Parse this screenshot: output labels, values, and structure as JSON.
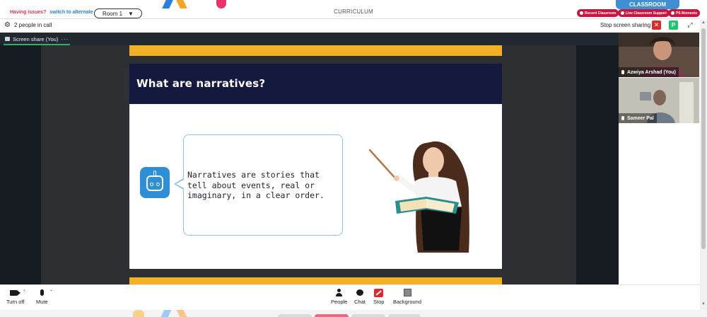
{
  "header": {
    "issues_question": "Having issues?",
    "issues_link": "switch to alternate room",
    "room_label": "Room 1",
    "room_caret": "▼",
    "center_title": "CURRICULUM",
    "classroom_tab": "CLASSROOM",
    "pills": [
      "Record Classroom",
      "Live Classroom Support",
      "PS Moments"
    ]
  },
  "callbar": {
    "people_in_call": "2 people in call",
    "stop_screen_sharing": "Stop screen sharing",
    "stop_icon": "✕",
    "avatar_letter": "P",
    "expand_icon": "⤢",
    "settings_icon": "⚙"
  },
  "share": {
    "tab_label": "Screen share (You)",
    "tab_more": "···"
  },
  "slide": {
    "title": "What are narratives?",
    "bubble_text": "Narratives are stories that tell about events, real or imaginary, in a clear order."
  },
  "participants": [
    {
      "name": "Azwiya Arshad (You)"
    },
    {
      "name": "Sameer Pal"
    }
  ],
  "controls": {
    "turn_off": "Turn off",
    "mute": "Mute",
    "people": "People",
    "chat": "Chat",
    "stop": "Stop",
    "background": "Background",
    "caret": "⌄"
  },
  "colors": {
    "accent_red": "#c7153f",
    "classroom_blue": "#3f8fd2",
    "slide_header": "#141a3d",
    "stripe_yellow": "#f2b125",
    "share_tab_underline": "#3ea86b"
  }
}
